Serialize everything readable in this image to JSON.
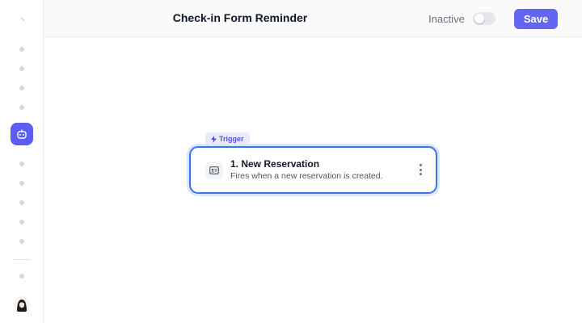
{
  "header": {
    "title": "Check-in Form Reminder",
    "status_label": "Inactive",
    "active": false,
    "save_label": "Save"
  },
  "sidebar": {
    "active_item_icon": "robot-icon",
    "nav_items": 10,
    "bottom_items": [
      "more-dot",
      "user-avatar"
    ]
  },
  "workflow": {
    "trigger_badge": "Trigger",
    "trigger_badge_icon": "bolt-icon",
    "node": {
      "title": "1. New Reservation",
      "description": "Fires when a new reservation is created.",
      "icon": "id-card-icon",
      "menu_icon": "kebab-menu-icon"
    }
  },
  "colors": {
    "accent": "#6366f1",
    "node_border": "#3b74e6",
    "trigger_badge_bg": "#eaeafb",
    "trigger_badge_text": "#4f52d9"
  }
}
